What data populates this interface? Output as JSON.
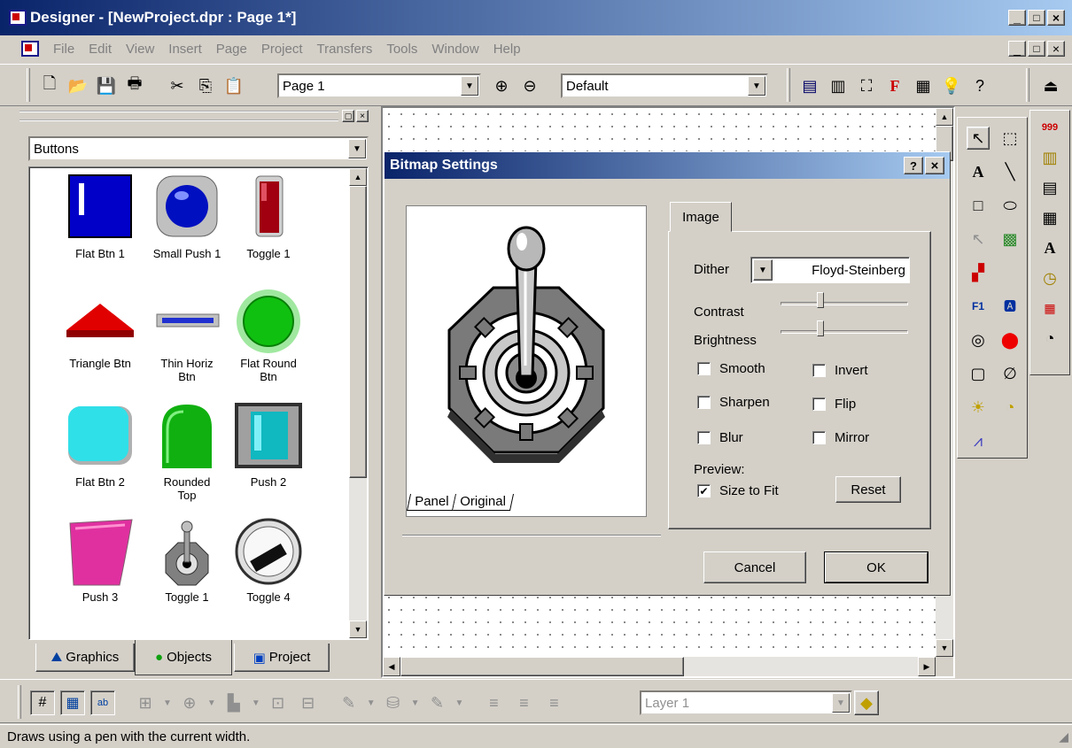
{
  "window": {
    "title": "Designer - [NewProject.dpr : Page 1*]"
  },
  "menu": [
    "File",
    "Edit",
    "View",
    "Insert",
    "Page",
    "Project",
    "Transfers",
    "Tools",
    "Window",
    "Help"
  ],
  "toolbar": {
    "page_value": "Page 1",
    "style_value": "Default"
  },
  "library": {
    "category": "Buttons",
    "items": [
      {
        "label": "Flat Btn 1",
        "icon": "flat-btn-1-icon"
      },
      {
        "label": "Small Push 1",
        "icon": "small-push-icon"
      },
      {
        "label": "Toggle 1",
        "icon": "toggle-1-icon"
      },
      {
        "label": "Triangle Btn",
        "icon": "triangle-btn-icon"
      },
      {
        "label": "Thin Horiz Btn",
        "icon": "thin-horiz-btn-icon"
      },
      {
        "label": "Flat Round Btn",
        "icon": "flat-round-btn-icon"
      },
      {
        "label": "Flat Btn 2",
        "icon": "flat-btn-2-icon"
      },
      {
        "label": "Rounded Top",
        "icon": "rounded-top-icon"
      },
      {
        "label": "Push 2",
        "icon": "push-2-icon"
      },
      {
        "label": "Push 3",
        "icon": "push-3-icon"
      },
      {
        "label": "Toggle 1",
        "icon": "toggle-joystick-icon"
      },
      {
        "label": "Toggle 4",
        "icon": "toggle-4-icon"
      }
    ],
    "tabs": [
      "Graphics",
      "Objects",
      "Project"
    ],
    "active_tab": "Objects"
  },
  "dialog": {
    "title": "Bitmap Settings",
    "preview_tabs": [
      "Panel",
      "Original"
    ],
    "image_tab": "Image",
    "dither_label": "Dither",
    "dither_value": "Floyd-Steinberg",
    "contrast_label": "Contrast",
    "contrast_level": 0.3,
    "brightness_label": "Brightness",
    "brightness_level": 0.3,
    "options": [
      {
        "label": "Smooth",
        "checked": false
      },
      {
        "label": "Invert",
        "checked": false
      },
      {
        "label": "Sharpen",
        "checked": false
      },
      {
        "label": "Flip",
        "checked": false
      },
      {
        "label": "Blur",
        "checked": false
      },
      {
        "label": "Mirror",
        "checked": false
      }
    ],
    "preview_label": "Preview:",
    "size_to_fit_label": "Size to Fit",
    "size_to_fit_checked": true,
    "reset_label": "Reset",
    "cancel_label": "Cancel",
    "ok_label": "OK"
  },
  "bottom_toolbar": {
    "layer_value": "Layer 1"
  },
  "status": {
    "text": "Draws using a pen with the current width."
  },
  "colors": {
    "title_start": "#0a246a",
    "title_end": "#a6caf0",
    "face": "#d4d0c8"
  }
}
